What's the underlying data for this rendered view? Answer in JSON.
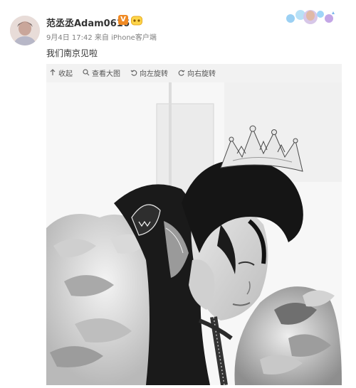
{
  "post": {
    "username": "范丞丞Adam0616",
    "verified_badge": "V",
    "meta": "9月4日 17:42 来自 iPhone客户端",
    "text": "我们南京见啦"
  },
  "toolbar": {
    "collect": "收起",
    "view_large": "查看大图",
    "rotate_left": "向左旋转",
    "rotate_right": "向右旋转"
  },
  "icons": [
    "arrow-up-icon",
    "magnify-icon",
    "rotate-left-icon",
    "rotate-right-icon"
  ],
  "colors": {
    "badge": "#f08a24",
    "text": "#333333",
    "meta": "#808080"
  }
}
